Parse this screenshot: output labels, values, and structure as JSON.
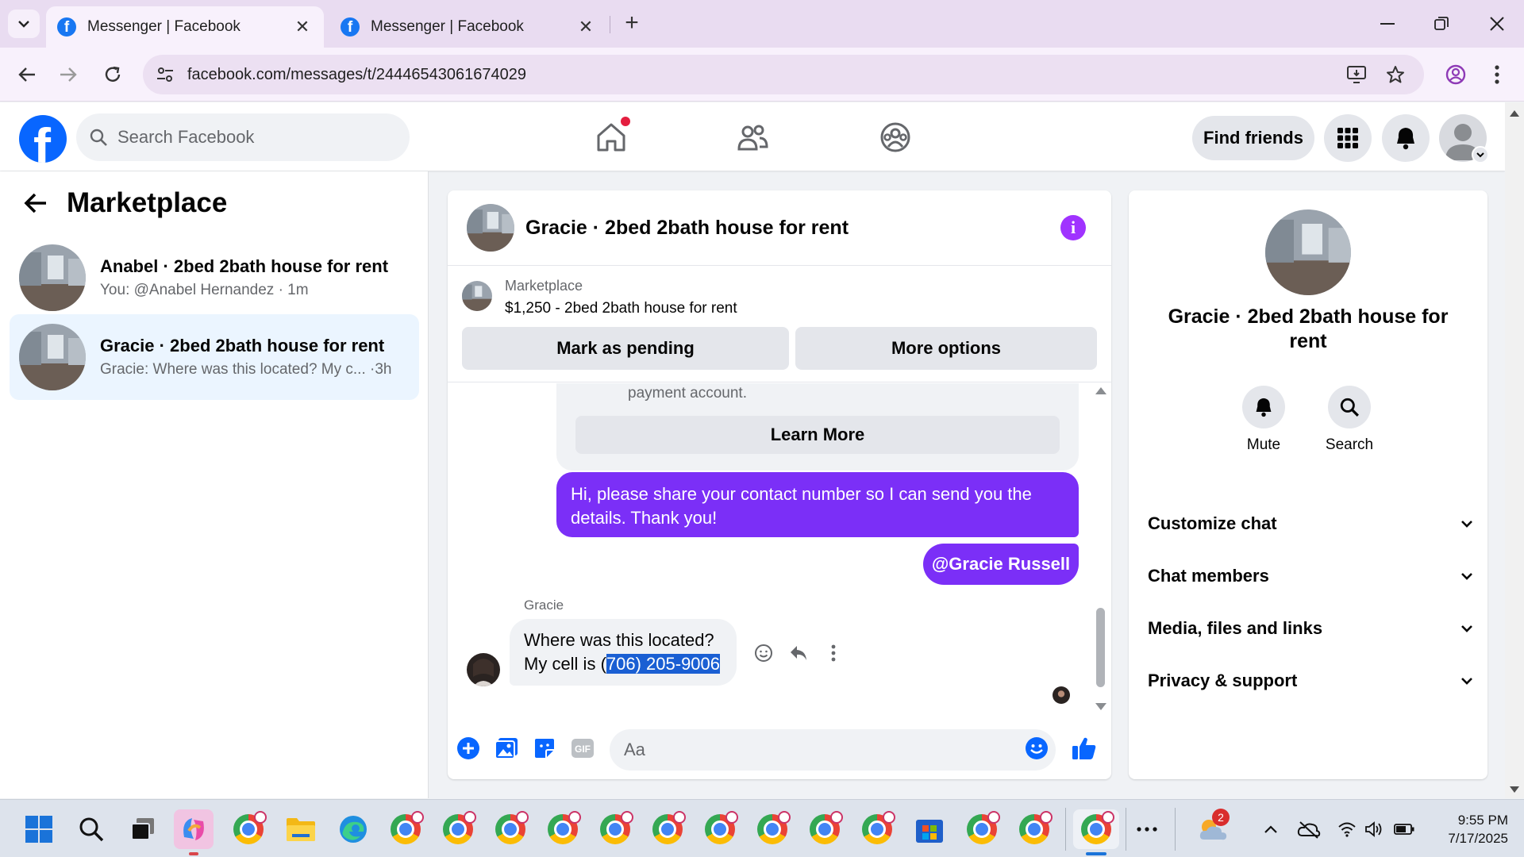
{
  "browser": {
    "tabs": [
      {
        "title": "Messenger | Facebook"
      },
      {
        "title": "Messenger | Facebook"
      }
    ],
    "url": "facebook.com/messages/t/24446543061674029"
  },
  "fb": {
    "search_placeholder": "Search Facebook",
    "find_friends": "Find friends"
  },
  "sidebar": {
    "title": "Marketplace",
    "conversations": [
      {
        "name": "Anabel · 2bed 2bath house for rent",
        "preview": "You: @Anabel Hernandez · 1m"
      },
      {
        "name": "Gracie · 2bed 2bath house for rent",
        "preview": "Gracie: Where was this located? My c...  ·3h"
      }
    ]
  },
  "chat": {
    "title": "Gracie · 2bed 2bath house for rent",
    "marketplace_label": "Marketplace",
    "listing": "$1,250 - 2bed 2bath house for rent",
    "mark_pending": "Mark as pending",
    "more_options": "More options",
    "card_text": "payment account.",
    "learn_more": "Learn More",
    "outgoing": "Hi, please share your contact number so I can send you the details. Thank you!",
    "mention": "@Gracie Russell",
    "sender": "Gracie",
    "incoming_line1": "Where was this located?",
    "incoming_line2_prefix": "My cell is ",
    "incoming_line2_sel_start": "(",
    "incoming_phone": "706) 205-9006",
    "input_placeholder": "Aa"
  },
  "info_panel": {
    "title": "Gracie · 2bed 2bath house for rent",
    "mute": "Mute",
    "search": "Search",
    "sections": [
      "Customize chat",
      "Chat members",
      "Media, files and links",
      "Privacy & support"
    ]
  },
  "taskbar": {
    "time": "9:55 PM",
    "date": "7/17/2025",
    "weather_badge": "2"
  },
  "colors": {
    "messenger_purple": "#7b2ff7",
    "facebook_blue": "#0866ff",
    "info_purple": "#a033ff"
  }
}
